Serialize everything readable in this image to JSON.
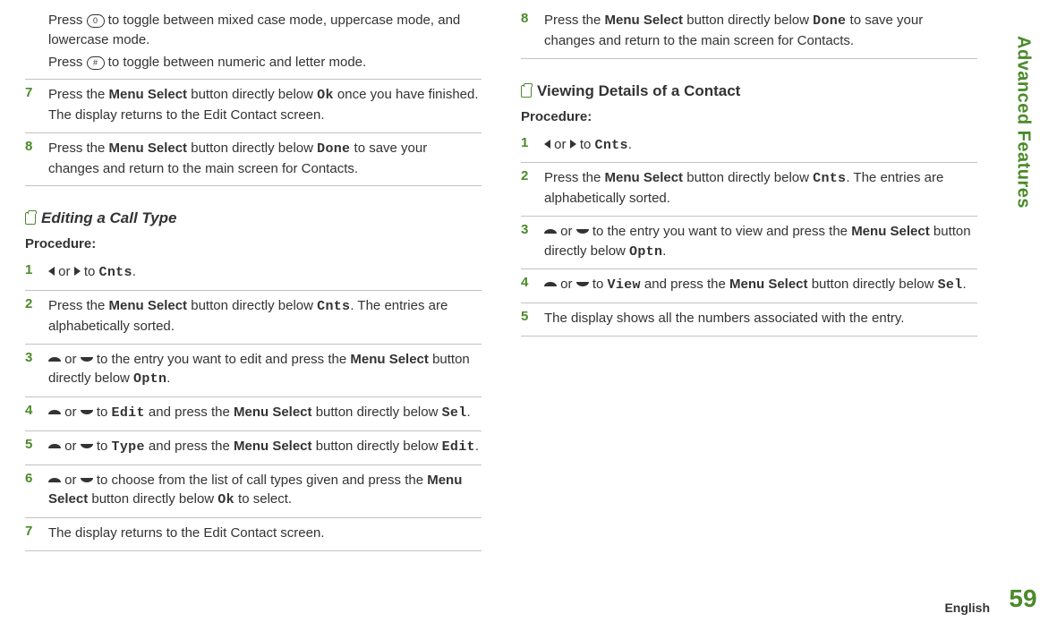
{
  "sidebar": {
    "label": "Advanced Features",
    "page": "59"
  },
  "lang": "English",
  "left": {
    "top_a": "Press ",
    "top_key0": "0",
    "top_b": " to toggle between mixed case mode, uppercase mode, and lowercase mode.",
    "top_c": "Press ",
    "top_keyhash": "#",
    "top_d": " to toggle between numeric and letter mode.",
    "s7_num": "7",
    "s7_a": "Press the ",
    "s7_ms": "Menu Select",
    "s7_b": " button directly below ",
    "s7_ok": "Ok",
    "s7_c": " once you have finished. The display returns to the Edit Contact screen.",
    "s8_num": "8",
    "s8_a": "Press the ",
    "s8_ms": "Menu Select",
    "s8_b": " button directly below ",
    "s8_done": "Done",
    "s8_c": " to save your changes and return to the main screen for Contacts.",
    "heading1": "Editing a Call Type",
    "proc": "Procedure:",
    "e1_num": "1",
    "e1_or": " or ",
    "e1_to": " to ",
    "e1_cnts": "Cnts",
    "e1_dot": ".",
    "e2_num": "2",
    "e2_a": "Press the ",
    "e2_ms": "Menu Select",
    "e2_b": " button directly below ",
    "e2_cnts": "Cnts",
    "e2_c": ". The entries are alphabetically sorted.",
    "e3_num": "3",
    "e3_or": " or ",
    "e3_a": " to the entry you want to edit and press the ",
    "e3_ms": "Menu Select",
    "e3_b": " button directly below ",
    "e3_optn": "Optn",
    "e3_dot": ".",
    "e4_num": "4",
    "e4_or": " or ",
    "e4_to": " to ",
    "e4_edit": "Edit",
    "e4_a": " and press the ",
    "e4_ms": "Menu Select",
    "e4_b": " button directly below ",
    "e4_sel": "Sel",
    "e4_dot": ".",
    "e5_num": "5",
    "e5_or": " or ",
    "e5_to": " to ",
    "e5_type": "Type",
    "e5_a": " and press the ",
    "e5_ms": "Menu Select",
    "e5_b": " button directly below ",
    "e5_edit": "Edit",
    "e5_dot": ".",
    "e6_num": "6",
    "e6_or": " or ",
    "e6_a": " to choose from the list of call types given and press the ",
    "e6_ms": "Menu Select",
    "e6_b": " button directly below ",
    "e6_ok": "Ok",
    "e6_c": " to select.",
    "e7_num": "7",
    "e7_a": "The display returns to the Edit Contact screen."
  },
  "right": {
    "r8_num": "8",
    "r8_a": "Press the ",
    "r8_ms": "Menu Select",
    "r8_b": " button directly below ",
    "r8_done": "Done",
    "r8_c": " to save your changes and return to the main screen for Contacts.",
    "heading2": "Viewing Details of a Contact",
    "proc": "Procedure:",
    "v1_num": "1",
    "v1_or": " or ",
    "v1_to": " to ",
    "v1_cnts": "Cnts",
    "v1_dot": ".",
    "v2_num": "2",
    "v2_a": "Press the ",
    "v2_ms": "Menu Select",
    "v2_b": " button directly below ",
    "v2_cnts": "Cnts",
    "v2_c": ". The entries are alphabetically sorted.",
    "v3_num": "3",
    "v3_or": " or ",
    "v3_a": " to the entry you want to view and press the ",
    "v3_ms": "Menu Select",
    "v3_b": " button directly below ",
    "v3_optn": "Optn",
    "v3_dot": ".",
    "v4_num": "4",
    "v4_or": " or ",
    "v4_to": " to ",
    "v4_view": "View",
    "v4_a": " and press the ",
    "v4_ms": "Menu Select",
    "v4_b": " button directly below ",
    "v4_sel": "Sel",
    "v4_dot": ".",
    "v5_num": "5",
    "v5_a": "The display shows all the numbers associated with the entry."
  }
}
